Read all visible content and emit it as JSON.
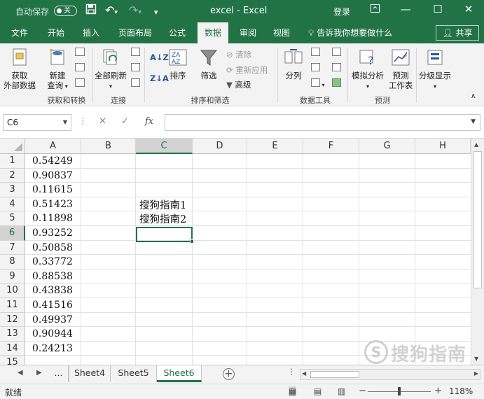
{
  "titlebar": {
    "autosave_label": "自动保存",
    "autosave_state": "关",
    "doc_title": "excel  -  Excel",
    "login_label": "登录"
  },
  "tabs": [
    {
      "label": "文件"
    },
    {
      "label": "开始"
    },
    {
      "label": "插入"
    },
    {
      "label": "页面布局"
    },
    {
      "label": "公式"
    },
    {
      "label": "数据"
    },
    {
      "label": "审阅"
    },
    {
      "label": "视图"
    }
  ],
  "active_tab": "数据",
  "tell_me": "告诉我你想要做什么",
  "share_label": "共享",
  "ribbon": {
    "get_data_1": "获取",
    "get_data_2": "外部数据",
    "new_query_1": "新建",
    "new_query_2": "查询",
    "group_get_transform": "获取和转换",
    "refresh_all": "全部刷新",
    "group_connections": "连接",
    "sort": "排序",
    "filter": "筛选",
    "clear": "清除",
    "reapply": "重新应用",
    "advanced": "高级",
    "group_sort_filter": "排序和筛选",
    "text_to_columns": "分列",
    "group_data_tools": "数据工具",
    "what_if": "模拟分析",
    "forecast_1": "预测",
    "forecast_2": "工作表",
    "group_forecast": "预测",
    "outline": "分级显示"
  },
  "formula_bar": {
    "name_box": "C6",
    "fx": "fx",
    "formula": ""
  },
  "columns": [
    "A",
    "B",
    "C",
    "D",
    "E",
    "F",
    "G",
    "H"
  ],
  "selected_column": "C",
  "rows": [
    "1",
    "2",
    "3",
    "4",
    "5",
    "6",
    "7",
    "8",
    "9",
    "10",
    "11",
    "12",
    "13",
    "14",
    "15"
  ],
  "selected_row": "6",
  "colA_values": [
    "0.54249",
    "0.90837",
    "0.11615",
    "0.51423",
    "0.11898",
    "0.93252",
    "0.50858",
    "0.33772",
    "0.88538",
    "0.43838",
    "0.41516",
    "0.49937",
    "0.90944",
    "0.24213"
  ],
  "colC_values": {
    "C4": "搜狗指南1",
    "C5": "搜狗指南2"
  },
  "sheets": [
    {
      "name": "Sheet4"
    },
    {
      "name": "Sheet5"
    },
    {
      "name": "Sheet6"
    }
  ],
  "active_sheet": "Sheet6",
  "sheet_more": "...",
  "status": {
    "ready": "就绪",
    "zoom": "118%"
  },
  "watermark": {
    "text": "搜狗指南",
    "url": "zhinan.sogou.com"
  },
  "colors": {
    "excel_green": "#217346",
    "ribbon_bg": "#f3f3f3"
  }
}
